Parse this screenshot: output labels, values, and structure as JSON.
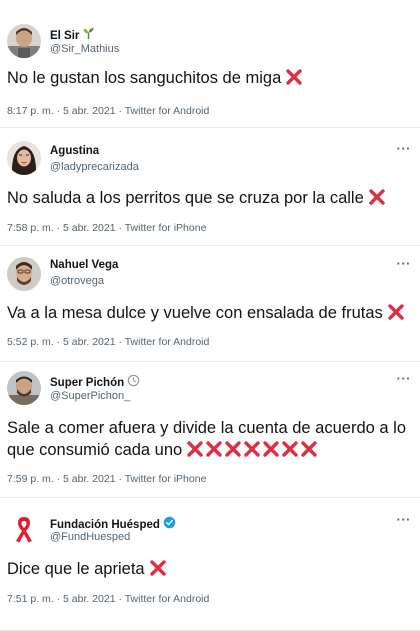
{
  "tweets": [
    {
      "name": "El Sir",
      "name_emoji": "seedling-icon",
      "handle": "@Sir_Mathius",
      "text": "No le gustan los sanguchitos de miga",
      "crosses": 1,
      "time": "8:17 p. m. · 5 abr. 2021 · Twitter for Android"
    },
    {
      "name": "Agustina",
      "handle": "@ladyprecarizada",
      "text": "No saluda a los perritos que se cruza por la calle",
      "crosses": 1,
      "time": "7:58 p. m. · 5 abr. 2021 · Twitter for iPhone"
    },
    {
      "name": "Nahuel Vega",
      "handle": "@otrovega",
      "text": "Va a la mesa dulce y vuelve con ensalada de frutas",
      "crosses": 1,
      "time": "5:52 p. m. · 5 abr. 2021 · Twitter for Android"
    },
    {
      "name": "Super Pichón",
      "name_emoji": "clock-icon",
      "handle": "@SuperPichon_",
      "text_line1": "Sale a comer afuera y divide la cuenta de acuerdo a lo",
      "text_line2": "que consumió cada uno",
      "crosses": 7,
      "time": "7:59 p. m. · 5 abr. 2021 · Twitter for iPhone"
    },
    {
      "name": "Fundación Huésped",
      "verified": true,
      "handle": "@FundHuesped",
      "text": "Dice que le aprieta",
      "crosses": 1,
      "time": "7:51 p. m. · 5 abr. 2021 · Twitter for Android"
    }
  ],
  "more_label": "···",
  "colors": {
    "cross": "#dd2e44",
    "verified": "#1d9bf0",
    "ribbon": "#e0202f",
    "secondary_text": "#536471"
  }
}
